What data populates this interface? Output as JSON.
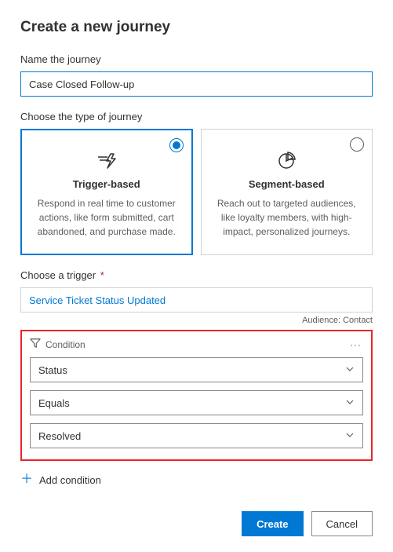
{
  "title": "Create a new journey",
  "name_section": {
    "label": "Name the journey",
    "value": "Case Closed Follow-up"
  },
  "type_section": {
    "label": "Choose the type of journey",
    "cards": [
      {
        "title": "Trigger-based",
        "desc": "Respond in real time to customer actions, like form submitted, cart abandoned, and purchase made.",
        "selected": true
      },
      {
        "title": "Segment-based",
        "desc": "Reach out to targeted audiences, like loyalty members, with high-impact, personalized journeys.",
        "selected": false
      }
    ]
  },
  "trigger_section": {
    "label": "Choose a trigger",
    "required_mark": "*",
    "value": "Service Ticket Status Updated",
    "audience_label": "Audience:",
    "audience_value": "Contact"
  },
  "condition_panel": {
    "header": "Condition",
    "more": "···",
    "selects": {
      "field": "Status",
      "operator": "Equals",
      "value": "Resolved"
    }
  },
  "add_condition_label": "Add condition",
  "footer": {
    "primary": "Create",
    "secondary": "Cancel"
  }
}
